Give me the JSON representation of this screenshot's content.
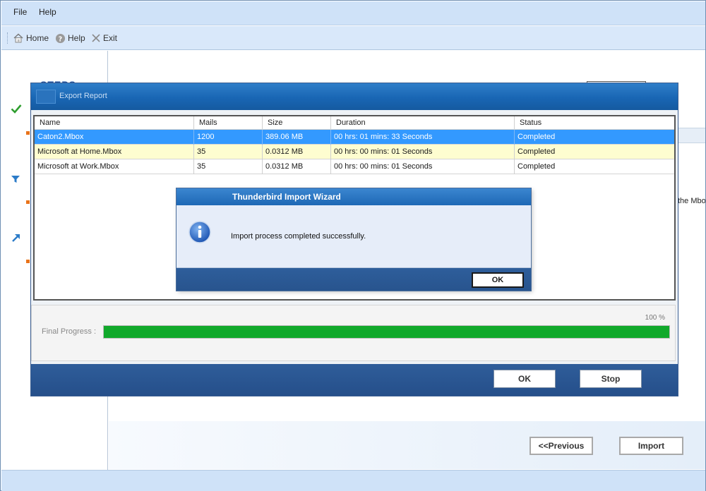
{
  "menu": {
    "file": "File",
    "help": "Help"
  },
  "toolbar": {
    "home": "Home",
    "help": "Help",
    "exit": "Exit"
  },
  "steps": {
    "title": "STEPS"
  },
  "right": {
    "fragment_text": "the Mbo"
  },
  "nav": {
    "previous": "<<Previous",
    "import": "Import"
  },
  "report": {
    "title": "Export Report",
    "columns": [
      "Name",
      "Mails",
      "Size",
      "Duration",
      "Status"
    ],
    "rows": [
      {
        "name": "Caton2.Mbox",
        "mails": "1200",
        "size": "389.06 MB",
        "duration": "00 hrs: 01 mins: 33 Seconds",
        "status": "Completed"
      },
      {
        "name": "Microsoft at Home.Mbox",
        "mails": "35",
        "size": "0.0312 MB",
        "duration": "00 hrs: 00 mins: 01 Seconds",
        "status": "Completed"
      },
      {
        "name": "Microsoft at Work.Mbox",
        "mails": "35",
        "size": "0.0312 MB",
        "duration": "00 hrs: 00 mins: 01 Seconds",
        "status": "Completed"
      }
    ],
    "progress_label": "Final Progress :",
    "progress_text": "100 %",
    "progress_value": 1.0,
    "ok_label": "OK",
    "stop_label": "Stop"
  },
  "wizard": {
    "title": "Thunderbird Import Wizard",
    "message": "Import process completed successfully.",
    "ok_label": "OK"
  },
  "colors": {
    "selected_row": "#3399ff",
    "highlight_row": "#fefdd0",
    "progress_fill": "#11a92b",
    "title_blue": "#1966b4",
    "footer_blue": "#2a5590"
  }
}
